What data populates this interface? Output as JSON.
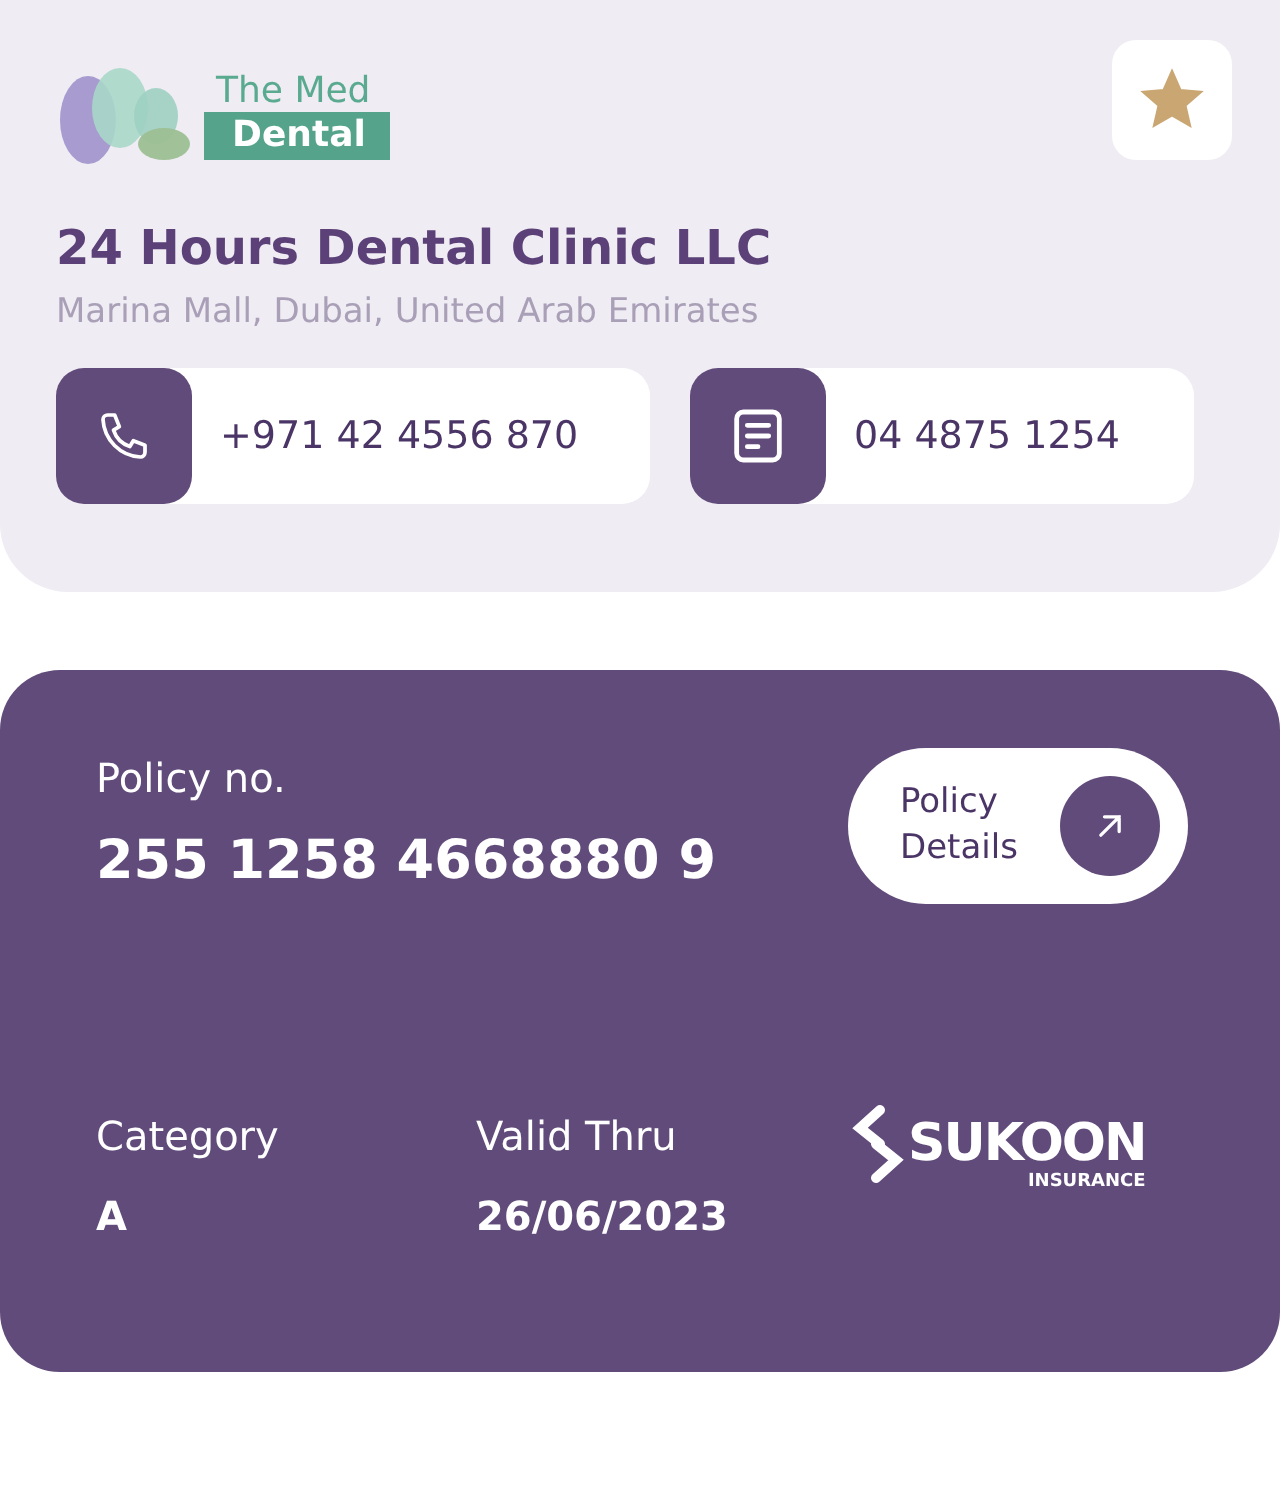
{
  "clinic": {
    "logo": {
      "line_1": "The Med",
      "line_2": "Dental"
    },
    "favorite": true,
    "name": "24 Hours Dental Clinic LLC",
    "address": "Marina Mall, Dubai, United Arab Emirates",
    "contacts": [
      {
        "kind": "phone",
        "value": "+971 42 4556 870"
      },
      {
        "kind": "fax",
        "value": "04 4875 1254"
      }
    ]
  },
  "policy": {
    "number_label": "Policy no.",
    "number": "255 1258 4668880 9",
    "details_button": {
      "line_1": "Policy",
      "line_2": "Details"
    },
    "fields": [
      {
        "label": "Category",
        "value": "A"
      },
      {
        "label": "Valid Thru",
        "value": "26/06/2023"
      }
    ],
    "insurer_logo": {
      "name": "SUKOON",
      "tagline": "INSURANCE"
    }
  }
}
